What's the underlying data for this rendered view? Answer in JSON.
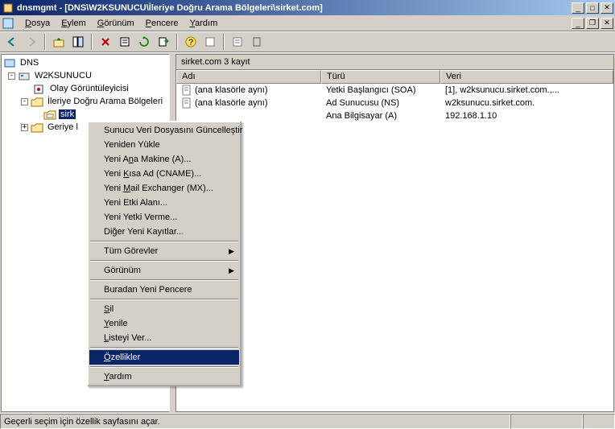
{
  "title": "dnsmgmt - [DNS\\W2KSUNUCU\\İleriye Doğru Arama Bölgeleri\\sirket.com]",
  "menubar": {
    "dosya": "Dosya",
    "eylem": "Eylem",
    "gorunum": "Görünüm",
    "pencere": "Pencere",
    "yardim": "Yardım"
  },
  "tree": {
    "root": "DNS",
    "server": "W2KSUNUCU",
    "event": "Olay Görüntüleyicisi",
    "fwd": "İleriye Doğru Arama Bölgeleri",
    "zone": "sirk",
    "rev": "Geriye l"
  },
  "list": {
    "info": "sirket.com   3 kayıt",
    "headers": {
      "name": "Adı",
      "type": "Türü",
      "data": "Veri"
    },
    "rows": [
      {
        "name": "(ana klasörle aynı)",
        "type": "Yetki Başlangıcı (SOA)",
        "data": "[1], w2ksunucu.sirket.com.,..."
      },
      {
        "name": "(ana klasörle aynı)",
        "type": "Ad Sunucusu (NS)",
        "data": "w2ksunucu.sirket.com."
      },
      {
        "name": "",
        "type": "Ana Bilgisayar (A)",
        "data": "192.168.1.10"
      }
    ]
  },
  "ctx": {
    "update": "Sunucu Veri Dosyasını Güncelleştir",
    "reload": "Yeniden Yükle",
    "hostA": "Yeni Ana Makine (A)...",
    "cname": "Yeni Kısa Ad (CNAME)...",
    "mx": "Yeni Mail Exchanger (MX)...",
    "domain": "Yeni Etki Alanı...",
    "deleg": "Yeni Yetki Verme...",
    "other": "Diğer Yeni Kayıtlar...",
    "alltasks": "Tüm Görevler",
    "view": "Görünüm",
    "newwin": "Buradan Yeni Pencere",
    "delete": "Sil",
    "refresh": "Yenile",
    "export": "Listeyi Ver...",
    "props": "Özellikler",
    "help": "Yardım"
  },
  "status": "Geçerli seçim için özellik sayfasını açar."
}
